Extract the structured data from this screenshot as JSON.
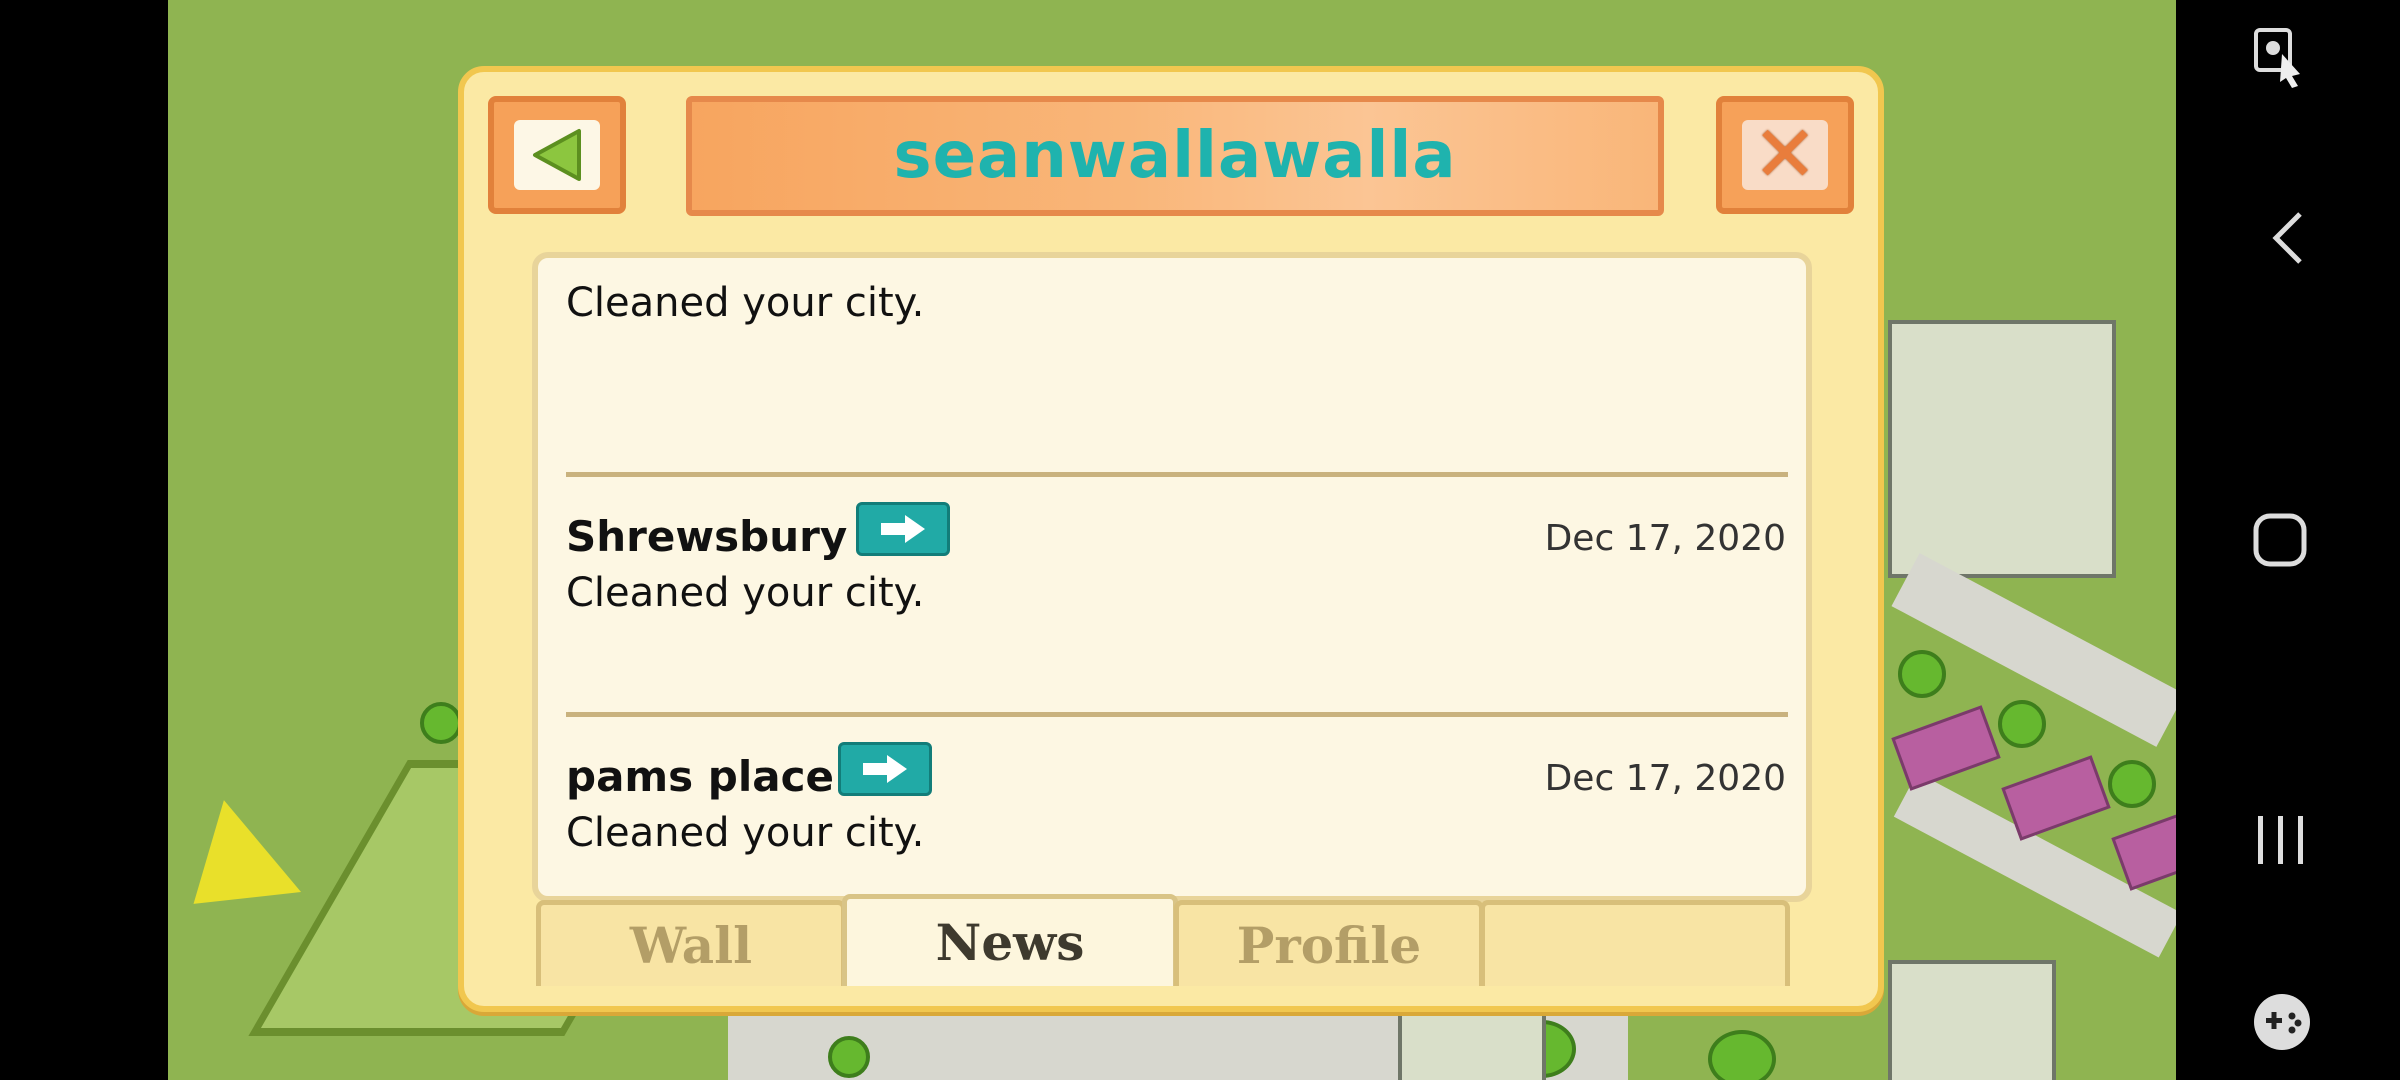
{
  "dialog": {
    "title": "seanwallawalla"
  },
  "feed": {
    "top_partial_text": "Cleaned your city.",
    "items": [
      {
        "name": "Shrewsbury",
        "date": "Dec 17, 2020",
        "text": "Cleaned your city."
      },
      {
        "name": "pams place",
        "date": "Dec 17, 2020",
        "text": "Cleaned your city."
      }
    ]
  },
  "tabs": {
    "wall": "Wall",
    "news": "News",
    "profile": "Profile",
    "active": "news"
  },
  "icons": {
    "back": "triangle-left-icon",
    "close": "close-x-icon",
    "visit": "arrow-right-icon",
    "system_nav": [
      "back-icon",
      "home-icon",
      "recents-icon",
      "gamepad-icon",
      "screenshot-icon"
    ]
  },
  "colors": {
    "title_text": "#1fb3ae",
    "dialog_bg": "#fbe9a4",
    "accent_orange": "#f6a159",
    "teal_button": "#21aaa6"
  }
}
